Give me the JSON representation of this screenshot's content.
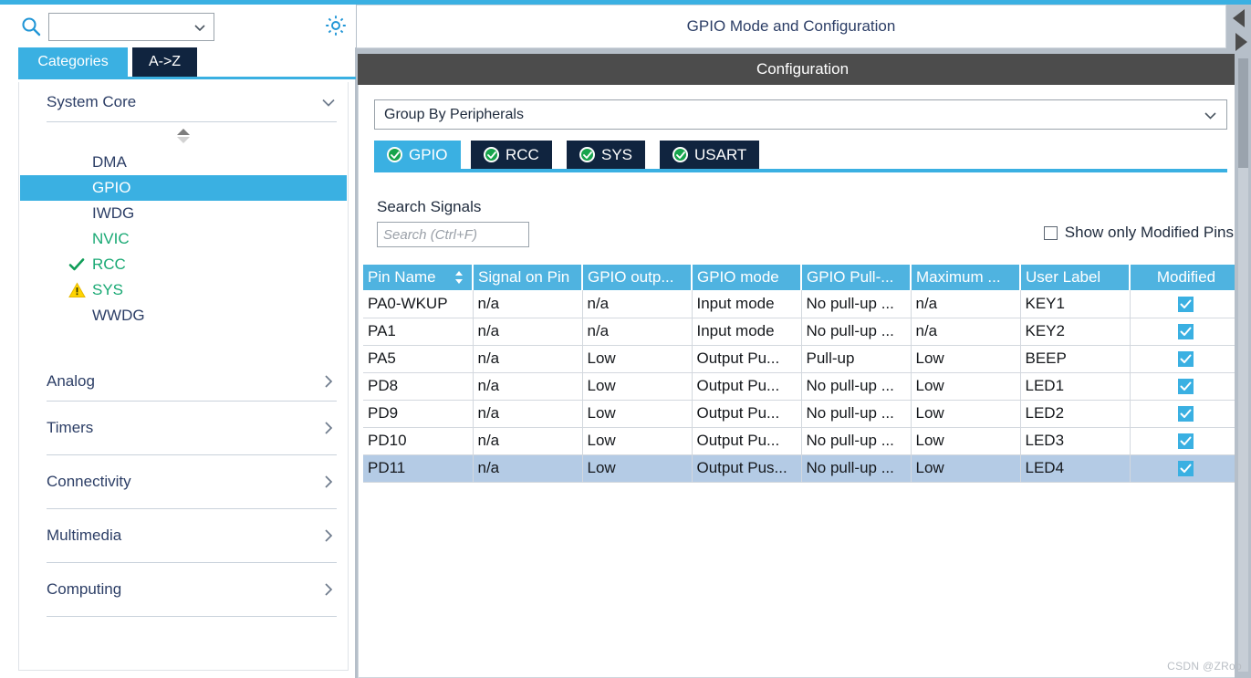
{
  "window": {
    "accent_blue": "#3ab0e2",
    "dark_navy": "#10243f",
    "config_bar_gray": "#4c4c4c",
    "green": "#19a974",
    "selected_row_blue": "#b4cbe5",
    "watermark": "CSDN @ZRob"
  },
  "sidebar": {
    "search": {
      "value": "",
      "placeholder": ""
    },
    "icons": {
      "search": "search-icon",
      "gear": "gear-icon",
      "chevron_down": "chevron-down-icon"
    },
    "tabs": [
      {
        "label": "Categories",
        "active": true
      },
      {
        "label": "A->Z",
        "active": false
      }
    ],
    "groups": [
      {
        "label": "System Core",
        "expanded": true,
        "items": [
          {
            "label": "DMA",
            "state": "none",
            "selected": false
          },
          {
            "label": "GPIO",
            "state": "none",
            "selected": true
          },
          {
            "label": "IWDG",
            "state": "none",
            "selected": false
          },
          {
            "label": "NVIC",
            "state": "enabled",
            "selected": false
          },
          {
            "label": "RCC",
            "state": "check",
            "selected": false
          },
          {
            "label": "SYS",
            "state": "warning",
            "selected": false
          },
          {
            "label": "WWDG",
            "state": "none",
            "selected": false
          }
        ]
      },
      {
        "label": "Analog",
        "expanded": false,
        "items": []
      },
      {
        "label": "Timers",
        "expanded": false,
        "items": []
      },
      {
        "label": "Connectivity",
        "expanded": false,
        "items": []
      },
      {
        "label": "Multimedia",
        "expanded": false,
        "items": []
      },
      {
        "label": "Computing",
        "expanded": false,
        "items": []
      }
    ]
  },
  "main": {
    "title": "GPIO Mode and Configuration",
    "configuration_bar": "Configuration",
    "group_by": {
      "selected": "Group By Peripherals"
    },
    "peripheral_tabs": [
      {
        "label": "GPIO",
        "active": true,
        "status": "ok"
      },
      {
        "label": "RCC",
        "active": false,
        "status": "ok"
      },
      {
        "label": "SYS",
        "active": false,
        "status": "ok"
      },
      {
        "label": "USART",
        "active": false,
        "status": "ok"
      }
    ],
    "search_signals": {
      "label": "Search Signals",
      "value": "",
      "placeholder": "Search (Ctrl+F)"
    },
    "show_modified_pins": {
      "label": "Show only Modified Pins",
      "checked": false
    },
    "table": {
      "columns": [
        "Pin Name",
        "Signal on Pin",
        "GPIO outp...",
        "GPIO mode",
        "GPIO Pull-...",
        "Maximum ...",
        "User Label",
        "Modified"
      ],
      "sorted_column": "Pin Name",
      "rows": [
        {
          "pin": "PA0-WKUP",
          "signal": "n/a",
          "output": "n/a",
          "mode": "Input mode",
          "pull": "No pull-up ...",
          "speed": "n/a",
          "label": "KEY1",
          "modified": true,
          "selected": false
        },
        {
          "pin": "PA1",
          "signal": "n/a",
          "output": "n/a",
          "mode": "Input mode",
          "pull": "No pull-up ...",
          "speed": "n/a",
          "label": "KEY2",
          "modified": true,
          "selected": false
        },
        {
          "pin": "PA5",
          "signal": "n/a",
          "output": "Low",
          "mode": "Output Pu...",
          "pull": "Pull-up",
          "speed": "Low",
          "label": "BEEP",
          "modified": true,
          "selected": false
        },
        {
          "pin": "PD8",
          "signal": "n/a",
          "output": "Low",
          "mode": "Output Pu...",
          "pull": "No pull-up ...",
          "speed": "Low",
          "label": "LED1",
          "modified": true,
          "selected": false
        },
        {
          "pin": "PD9",
          "signal": "n/a",
          "output": "Low",
          "mode": "Output Pu...",
          "pull": "No pull-up ...",
          "speed": "Low",
          "label": "LED2",
          "modified": true,
          "selected": false
        },
        {
          "pin": "PD10",
          "signal": "n/a",
          "output": "Low",
          "mode": "Output Pu...",
          "pull": "No pull-up ...",
          "speed": "Low",
          "label": "LED3",
          "modified": true,
          "selected": false
        },
        {
          "pin": "PD11",
          "signal": "n/a",
          "output": "Low",
          "mode": "Output Pus...",
          "pull": "No pull-up ...",
          "speed": "Low",
          "label": "LED4",
          "modified": true,
          "selected": true
        }
      ]
    }
  }
}
